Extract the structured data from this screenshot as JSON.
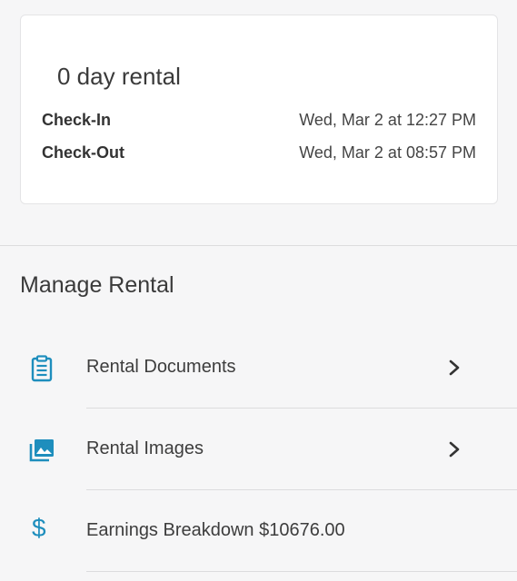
{
  "rental_card": {
    "title": "0 day rental",
    "checkin_label": "Check-In",
    "checkin_value": "Wed, Mar 2 at 12:27 PM",
    "checkout_label": "Check-Out",
    "checkout_value": "Wed, Mar 2 at 08:57 PM"
  },
  "manage": {
    "title": "Manage Rental",
    "items": [
      {
        "label": "Rental Documents",
        "icon": "clipboard-icon"
      },
      {
        "label": "Rental Images",
        "icon": "images-icon"
      },
      {
        "label": "Earnings Breakdown $10676.00",
        "icon": "dollar-icon"
      }
    ]
  },
  "colors": {
    "accent": "#1e8ebd",
    "background": "#f6f6f7",
    "card": "#ffffff"
  }
}
